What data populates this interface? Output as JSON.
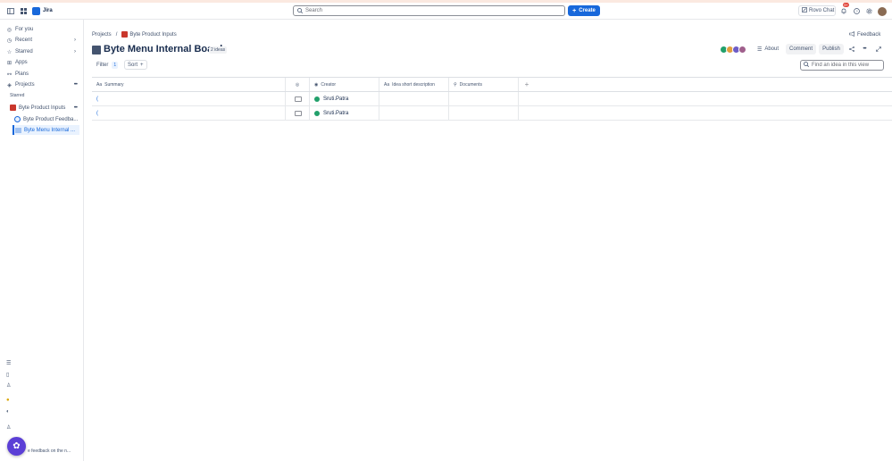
{
  "topbar": {
    "app_name": "Jira",
    "search_placeholder": "Search",
    "create_label": "Create",
    "rovo_label": "Rovo Chat",
    "notifications_count": "9+"
  },
  "sidebar": {
    "items": [
      {
        "label": "For you"
      },
      {
        "label": "Recent"
      },
      {
        "label": "Starred"
      },
      {
        "label": "Apps"
      },
      {
        "label": "Plans"
      },
      {
        "label": "Projects"
      }
    ],
    "starred_label": "Starred",
    "projects": [
      {
        "label": "Byte Product Inputs"
      },
      {
        "label": "Byte Product Feedba..."
      },
      {
        "label": "Byte Menu Internal ..."
      }
    ],
    "feedback_text": "e feedback on the n..."
  },
  "header": {
    "breadcrumb_root": "Projects",
    "breadcrumb_sep": "/",
    "breadcrumb_project": "Byte Product Inputs",
    "feedback_label": "Feedback",
    "title": "Byte Menu Internal Board",
    "ideas_count": "2 ideas",
    "about_label": "About",
    "comment_label": "Comment",
    "publish_label": "Publish"
  },
  "toolbar": {
    "filter_label": "Filter",
    "filter_count": "1",
    "sort_label": "Sort",
    "find_placeholder": "Find an idea in this view"
  },
  "table": {
    "columns": [
      {
        "label": "Summary"
      },
      {
        "label": ""
      },
      {
        "label": "Creator"
      },
      {
        "label": "Idea short description"
      },
      {
        "label": "Documents"
      }
    ],
    "rows": [
      {
        "summary": "(",
        "creator": "Sruti.Patra"
      },
      {
        "summary": "(",
        "creator": "Sruti.Patra"
      }
    ]
  },
  "colors": {
    "brand": "#1868db",
    "notif": "#e2483d",
    "creator_avatar": "#22a06b"
  }
}
